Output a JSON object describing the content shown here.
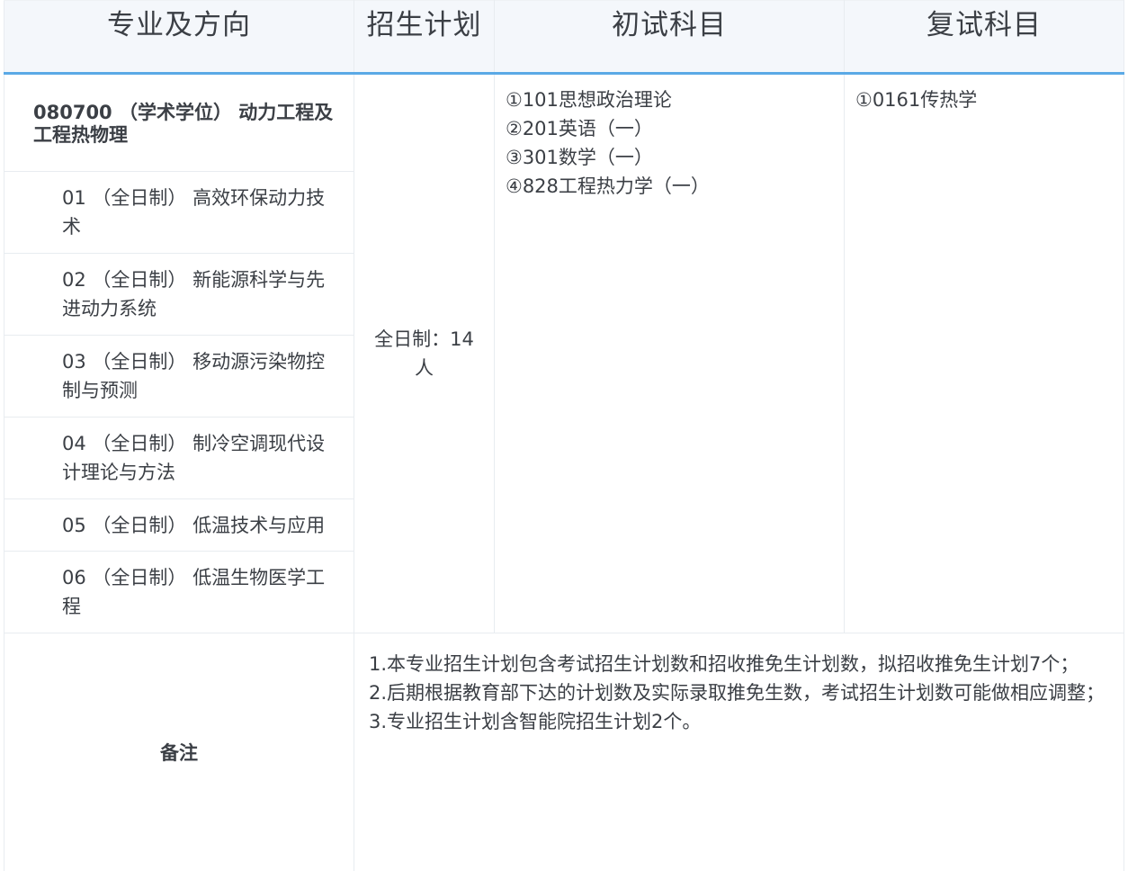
{
  "header": {
    "col1": "专业及方向",
    "col2": "招生计划",
    "col3": "初试科目",
    "col4": "复试科目"
  },
  "major": {
    "title": "080700 （学术学位） 动力工程及工程热物理"
  },
  "directions": [
    {
      "label": "01 （全日制） 高效环保动力技术"
    },
    {
      "label": "02 （全日制） 新能源科学与先进动力系统"
    },
    {
      "label": "03 （全日制） 移动源污染物控制与预测"
    },
    {
      "label": "04 （全日制） 制冷空调现代设计理论与方法"
    },
    {
      "label": "05 （全日制） 低温技术与应用"
    },
    {
      "label": "06 （全日制） 低温生物医学工程"
    }
  ],
  "plan": {
    "text": "全日制：14人"
  },
  "initial_subjects": [
    "①101思想政治理论",
    "②201英语（一）",
    "③301数学（一）",
    "④828工程热力学（一）"
  ],
  "retest_subjects": [
    "①0161传热学"
  ],
  "remarks": {
    "label": "备注",
    "lines": [
      "1.本专业招生计划包含考试招生计划数和招收推免生计划数，拟招收推免生计划7个；",
      "2.后期根据教育部下达的计划数及实际录取推免生数，考试招生计划数可能做相应调整；",
      "3.专业招生计划含智能院招生计划2个。"
    ]
  }
}
